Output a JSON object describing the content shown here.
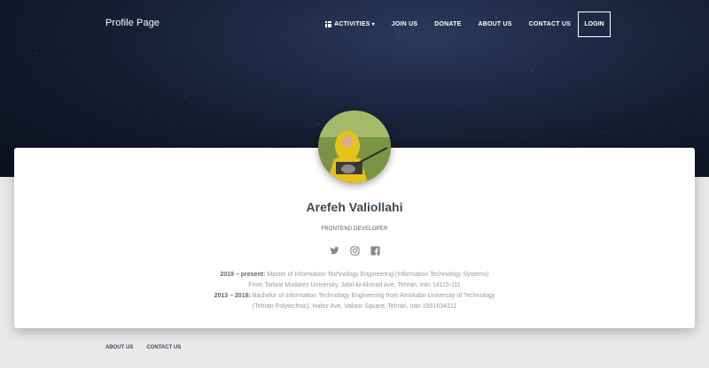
{
  "brand": "Profile Page",
  "nav": {
    "activities": "ACTIVITIES",
    "join": "JOIN US",
    "donate": "DONATE",
    "about": "ABOUT US",
    "contact": "CONTACT US",
    "login": "LOGIN"
  },
  "profile": {
    "name": "Arefeh Valiollahi",
    "role": "FRONTEND DEVELOPER",
    "avatar_alt": "profile photo"
  },
  "social_icons": [
    "twitter-icon",
    "instagram-icon",
    "facebook-icon"
  ],
  "bio": [
    {
      "period": "2019 – present:",
      "text": "Master of Information Technology Engineering (Information Technology Systems) From Tarbiat Modares University, Jalal Al-Ahmad Ave, Tehran, Iran 14115-111"
    },
    {
      "period": "2013 – 2018:",
      "text": "Bachelor of Information Technology Engineering from Amirkabir University of Technology (Tehran Polytechnic), Hafez Ave, Valiasr Square, Tehran, Iran 1591634311"
    }
  ],
  "footer": {
    "about": "ABOUT US",
    "contact": "CONTACT US"
  },
  "colors": {
    "hero_dark": "#0b101d",
    "title_text": "#3c4858",
    "card_bg": "#ffffff",
    "page_bg": "#e9e9e9"
  }
}
